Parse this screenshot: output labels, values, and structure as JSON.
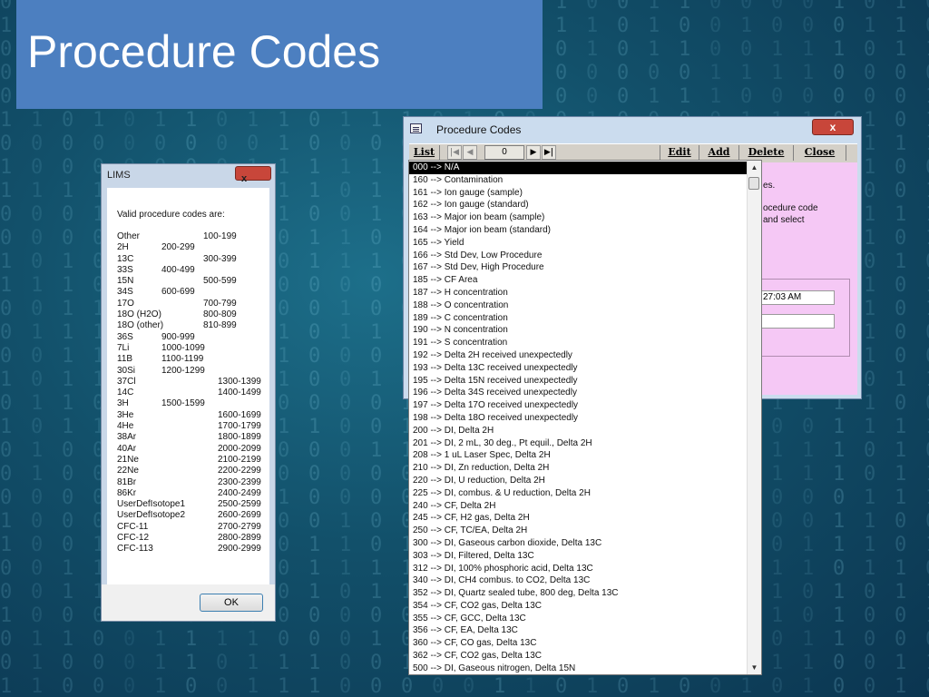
{
  "slide": {
    "title": "Procedure Codes"
  },
  "lims_dialog": {
    "title": "LIMS",
    "close_symbol": "x",
    "intro": "Valid procedure codes are:",
    "codes": [
      {
        "name": "Other",
        "range": "100-199",
        "indent": 1
      },
      {
        "name": "2H",
        "range": "200-299",
        "indent": 0
      },
      {
        "name": "13C",
        "range": "300-399",
        "indent": 1
      },
      {
        "name": "33S",
        "range": "400-499",
        "indent": 0
      },
      {
        "name": "15N",
        "range": "500-599",
        "indent": 1
      },
      {
        "name": "34S",
        "range": "600-699",
        "indent": 0
      },
      {
        "name": "17O",
        "range": "700-799",
        "indent": 1
      },
      {
        "name": "18O (H2O)",
        "range": "800-809",
        "indent": 1
      },
      {
        "name": "18O (other)",
        "range": "810-899",
        "indent": 1
      },
      {
        "name": "36S",
        "range": "900-999",
        "indent": 0
      },
      {
        "name": "7Li",
        "range": "1000-1099",
        "indent": 0
      },
      {
        "name": "11B",
        "range": "1100-1199",
        "indent": 0
      },
      {
        "name": "30Si",
        "range": "1200-1299",
        "indent": 0
      },
      {
        "name": "37Cl",
        "range": "1300-1399",
        "indent": 2
      },
      {
        "name": "14C",
        "range": "1400-1499",
        "indent": 2
      },
      {
        "name": "3H",
        "range": "1500-1599",
        "indent": 0
      },
      {
        "name": "3He",
        "range": "1600-1699",
        "indent": 2
      },
      {
        "name": "4He",
        "range": "1700-1799",
        "indent": 2
      },
      {
        "name": "38Ar",
        "range": "1800-1899",
        "indent": 2
      },
      {
        "name": "40Ar",
        "range": "2000-2099",
        "indent": 2
      },
      {
        "name": "21Ne",
        "range": "2100-2199",
        "indent": 2
      },
      {
        "name": "22Ne",
        "range": "2200-2299",
        "indent": 2
      },
      {
        "name": "81Br",
        "range": "2300-2399",
        "indent": 2
      },
      {
        "name": "86Kr",
        "range": "2400-2499",
        "indent": 2
      },
      {
        "name": "UserDefIsotope1",
        "range": "2500-2599",
        "indent": 2
      },
      {
        "name": "UserDefIsotope2",
        "range": "2600-2699",
        "indent": 2
      },
      {
        "name": "CFC-11",
        "range": "2700-2799",
        "indent": 2
      },
      {
        "name": "CFC-12",
        "range": "2800-2899",
        "indent": 2
      },
      {
        "name": "CFC-113",
        "range": "2900-2999",
        "indent": 2
      }
    ],
    "ok_label": "OK"
  },
  "procedure_window": {
    "title": "Procedure Codes",
    "close_symbol": "x",
    "toolbar": {
      "list_label": "List",
      "record_number": "0",
      "edit_label": "Edit",
      "add_label": "Add",
      "delete_label": "Delete",
      "close_label": "Close"
    },
    "right_panel": {
      "text1": "es.",
      "text2": "ocedure code",
      "text3": "and select",
      "time_value": "27:03 AM",
      "empty_value": ""
    },
    "list_items": [
      "000 --> N/A",
      "160 --> Contamination",
      "161 --> Ion gauge (sample)",
      "162 --> Ion gauge (standard)",
      "163 --> Major ion beam (sample)",
      "164 --> Major ion beam (standard)",
      "165 --> Yield",
      "166 --> Std Dev, Low Procedure",
      "167 --> Std Dev, High Procedure",
      "185 --> CF Area",
      "187 --> H concentration",
      "188 --> O concentration",
      "189 --> C concentration",
      "190 --> N concentration",
      "191 --> S concentration",
      "192 --> Delta 2H received unexpectedly",
      "193 --> Delta 13C received unexpectedly",
      "195 --> Delta 15N received unexpectedly",
      "196 --> Delta 34S received unexpectedly",
      "197 --> Delta 17O received unexpectedly",
      "198 --> Delta 18O received unexpectedly",
      "200 --> DI, Delta 2H",
      "201 --> DI, 2 mL, 30 deg., Pt equil., Delta 2H",
      "208 --> 1 uL Laser Spec, Delta 2H",
      "210 --> DI, Zn reduction, Delta 2H",
      "220 --> DI, U reduction, Delta 2H",
      "225 --> DI, combus. & U reduction, Delta 2H",
      "240 --> CF, Delta 2H",
      "245 --> CF, H2 gas, Delta 2H",
      "250 --> CF, TC/EA, Delta 2H",
      "300 --> DI, Gaseous carbon dioxide, Delta 13C",
      "303 --> DI, Filtered, Delta 13C",
      "312 --> DI, 100% phosphoric acid, Delta 13C",
      "340 --> DI, CH4 combus. to CO2, Delta 13C",
      "352 --> DI, Quartz sealed tube, 800 deg, Delta 13C",
      "354 --> CF, CO2 gas, Delta 13C",
      "355 --> CF, GCC, Delta 13C",
      "356 --> CF, EA, Delta 13C",
      "360 --> CF, CO gas, Delta 13C",
      "362 --> CF, CO2 gas, Delta 13C",
      "500 --> DI, Gaseous nitrogen, Delta 15N"
    ],
    "selected_index": 0
  }
}
